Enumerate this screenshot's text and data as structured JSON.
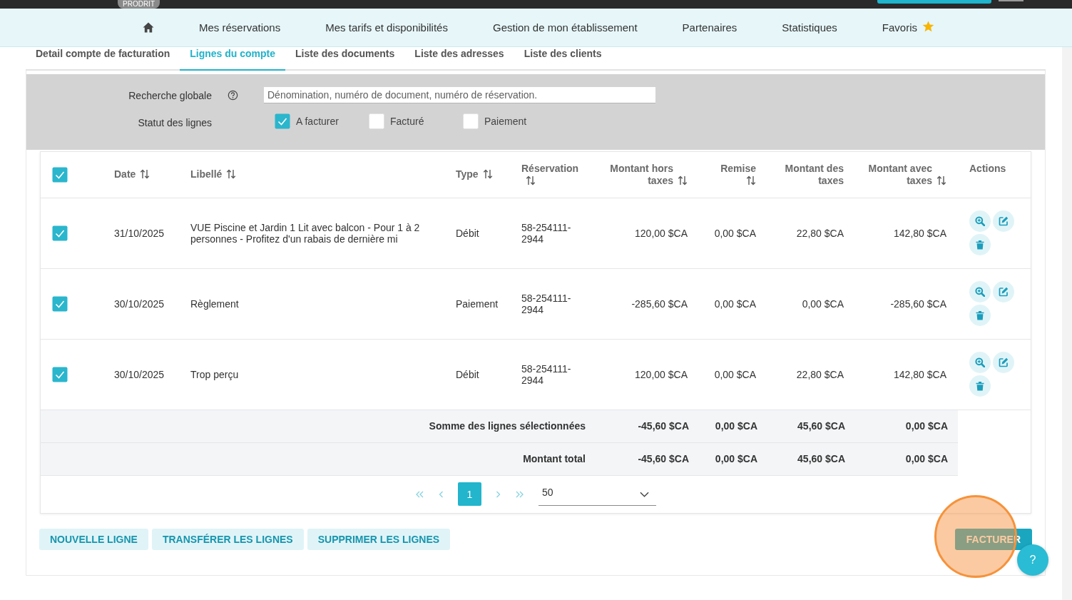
{
  "top_bar": {
    "badge": "PRODRIT"
  },
  "nav": {
    "items": [
      {
        "kind": "home"
      },
      {
        "kind": "link",
        "label": "Mes réservations"
      },
      {
        "kind": "link",
        "label": "Mes tarifs et disponibilités"
      },
      {
        "kind": "link",
        "label": "Gestion de mon établissement"
      },
      {
        "kind": "link",
        "label": "Partenaires"
      },
      {
        "kind": "link",
        "label": "Statistiques"
      },
      {
        "kind": "favorites",
        "label": "Favoris"
      }
    ]
  },
  "subtabs": [
    {
      "label": "Detail compte de facturation",
      "selected": false
    },
    {
      "label": "Lignes du compte",
      "selected": true
    },
    {
      "label": "Liste des documents",
      "selected": false
    },
    {
      "label": "Liste des adresses",
      "selected": false
    },
    {
      "label": "Liste des clients",
      "selected": false
    }
  ],
  "filters": {
    "search": {
      "label": "Recherche globale",
      "placeholder": "Dénomination, numéro de document, numéro de réservation."
    },
    "status": {
      "label": "Statut des lignes",
      "options": [
        {
          "label": "A facturer",
          "checked": true
        },
        {
          "label": "Facturé",
          "checked": false
        },
        {
          "label": "Paiement",
          "checked": false
        }
      ]
    }
  },
  "table": {
    "select_all": {
      "checked": true
    },
    "columns": [
      {
        "label": "Date",
        "sortable": true
      },
      {
        "label": "Libellé",
        "sortable": true
      },
      {
        "label": "Type",
        "sortable": true
      },
      {
        "label": "Réservation",
        "sortable": true
      },
      {
        "label": "Montant hors taxes",
        "sortable": true
      },
      {
        "label": "Remise",
        "sortable": true
      },
      {
        "label": "Montant des taxes",
        "sortable": false
      },
      {
        "label": "Montant avec taxes",
        "sortable": true
      },
      {
        "label": "Actions",
        "sortable": false
      }
    ],
    "rows": [
      {
        "checked": true,
        "cells": [
          "31/10/2025",
          "VUE Piscine et Jardin 1 Lit avec balcon - Pour 1 à 2 personnes - Profitez d'un rabais de dernière mi",
          "Débit",
          "58-254111-2944",
          "120,00 $CA",
          "0,00 $CA",
          "22,80 $CA",
          "142,80 $CA"
        ]
      },
      {
        "checked": true,
        "cells": [
          "30/10/2025",
          "Règlement",
          "Paiement",
          "58-254111-2944",
          "-285,60 $CA",
          "0,00 $CA",
          "0,00 $CA",
          "-285,60 $CA"
        ]
      },
      {
        "checked": true,
        "cells": [
          "30/10/2025",
          "Trop perçu",
          "Débit",
          "58-254111-2944",
          "120,00 $CA",
          "0,00 $CA",
          "22,80 $CA",
          "142,80 $CA"
        ]
      }
    ],
    "totals": [
      {
        "label": "Somme des lignes sélectionnées",
        "values": [
          "-45,60 $CA",
          "0,00 $CA",
          "45,60 $CA",
          "0,00 $CA"
        ]
      },
      {
        "label": "Montant total",
        "values": [
          "-45,60 $CA",
          "0,00 $CA",
          "45,60 $CA",
          "0,00 $CA"
        ]
      }
    ]
  },
  "pagination": {
    "pages": [
      {
        "label": "1",
        "selected": true
      }
    ],
    "page_size": "50"
  },
  "buttons": [
    {
      "label": "NOUVELLE LIGNE",
      "kind": "secondary",
      "highlighted": false
    },
    {
      "label": "TRANSFÉRER LES LIGNES",
      "kind": "secondary",
      "highlighted": false
    },
    {
      "label": "SUPPRIMER LES LIGNES",
      "kind": "secondary",
      "highlighted": false
    },
    {
      "label": "FACTURER",
      "kind": "primary",
      "highlighted": true
    }
  ],
  "help_button": {
    "label": "?"
  }
}
